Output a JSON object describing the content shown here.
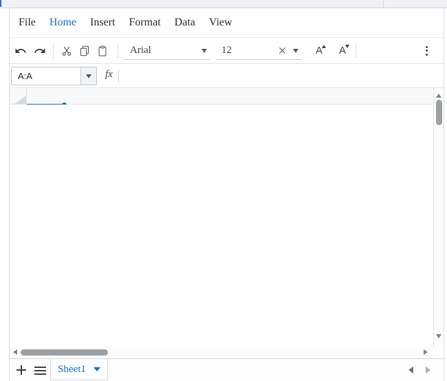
{
  "menubar": {
    "items": [
      "File",
      "Home",
      "Insert",
      "Format",
      "Data",
      "View"
    ],
    "active_item": "Home"
  },
  "toolbar": {
    "font_family_value": "Arial",
    "font_size_value": "12",
    "increase_font_label": "A",
    "decrease_font_label": "A"
  },
  "formula_bar": {
    "name_box_value": "A:A",
    "fx_label": "fx",
    "formula_value": ""
  },
  "grid": {
    "selected_range": "A:A",
    "cells": []
  },
  "sheet_bar": {
    "active_sheet_label": "Sheet1"
  },
  "icons": {
    "undo": "curved-arrow-left",
    "redo": "curved-arrow-right",
    "cut": "scissors",
    "copy": "overlapping-pages",
    "paste": "clipboard",
    "font_family_dropdown": "caret-down",
    "font_size_clear": "x-cross",
    "font_size_dropdown": "caret-down",
    "increase_font": "A-with-up-caret",
    "decrease_font": "A-with-down-caret",
    "overflow_menu": "kebab-vertical-dots",
    "name_box_dropdown": "caret-down",
    "select_all": "corner-triangle",
    "add_sheet": "plus",
    "sheet_list": "hamburger-menu",
    "sheet_tab_dropdown": "caret-down",
    "prev_sheet": "caret-left",
    "next_sheet": "caret-right",
    "scroll_up": "triangle-up",
    "scroll_down": "triangle-down",
    "scroll_left": "triangle-left",
    "scroll_right": "triangle-right"
  },
  "colors": {
    "accent_blue": "#1b6ac9",
    "selection_blue": "#1273a8",
    "icon_gray": "#3c4043",
    "header_bg": "#f8f9fa",
    "scrollbar_thumb": "#9da0a3",
    "strip_bg": "#eff1f4"
  }
}
